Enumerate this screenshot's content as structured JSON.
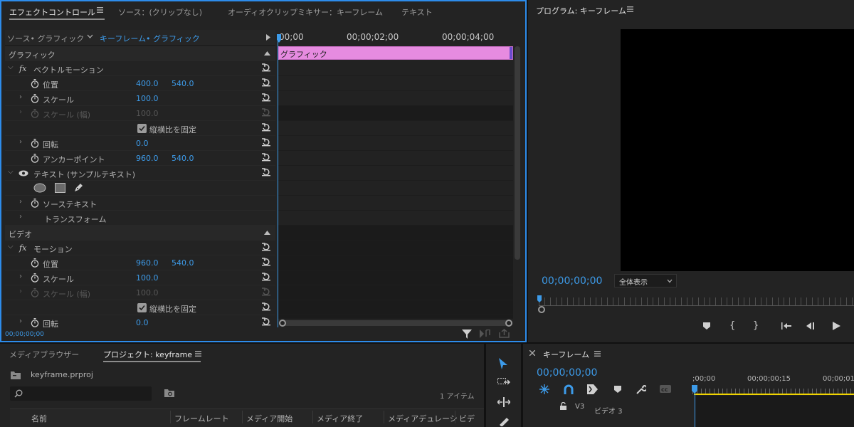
{
  "effect_panel": {
    "tabs": [
      "エフェクトコントロール",
      "ソース：(クリップなし)",
      "オーディオクリップミキサー：キーフレーム",
      "テキスト"
    ],
    "source_label": "ソース• グラフィック",
    "target_label": "キーフレーム• グラフィック",
    "timecodes": [
      "00;00",
      "00;00;02;00",
      "00;00;04;00"
    ],
    "clip_label": "グラフィック",
    "section_graphic": "グラフィック",
    "vector_motion": "ベクトルモーション",
    "position_label": "位置",
    "position_x": "400.0",
    "position_y": "540.0",
    "scale_label": "スケール",
    "scale_value": "100.0",
    "scale_width_label": "スケール (幅)",
    "scale_width_value": "100.0",
    "uniform_label": "縦横比を固定",
    "rotation_label": "回転",
    "rotation_value": "0.0",
    "anchor_label": "アンカーポイント",
    "anchor_x": "960.0",
    "anchor_y": "540.0",
    "text_layer": "テキスト (サンプルテキスト)",
    "source_text": "ソーステキスト",
    "transform": "トランスフォーム",
    "section_video": "ビデオ",
    "motion": "モーション",
    "motion_position_x": "960.0",
    "motion_position_y": "540.0",
    "motion_scale_value": "100.0",
    "motion_scale_width_value": "100.0",
    "motion_rotation_value": "0.0",
    "bottom_timecode": "00;00;00;00"
  },
  "program_monitor": {
    "title": "プログラム: キーフレーム",
    "timecode": "00;00;00;00",
    "zoom_select": "全体表示"
  },
  "project_panel": {
    "tabs": [
      "メディアブラウザー",
      "プロジェクト: keyframe"
    ],
    "project_file": "keyframe.prproj",
    "item_count": "1 アイテム",
    "columns": [
      "名前",
      "フレームレート",
      "メディア開始",
      "メディア終了",
      "メディアデュレーシ",
      "ビデ"
    ]
  },
  "timeline_panel": {
    "title": "キーフレーム",
    "timecode": "00;00;00;00",
    "ruler": [
      ";00;00",
      "00;00;00;15",
      "00;00;01"
    ],
    "track_label": "V3",
    "track_name": "ビデオ 3"
  },
  "colors": {
    "accent": "#3d9be9",
    "clip": "#e68be0",
    "panel_bg": "#232323",
    "playhead_yellow": "#f0d400"
  }
}
